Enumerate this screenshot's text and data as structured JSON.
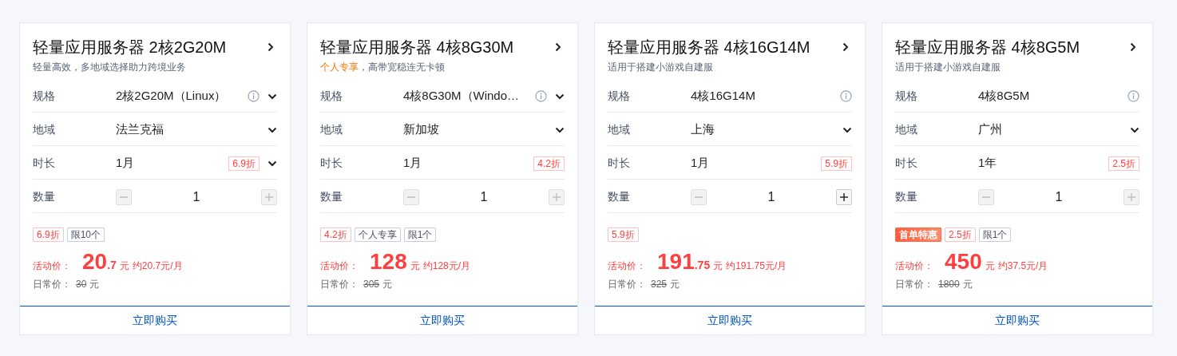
{
  "cards": [
    {
      "title": "轻量应用服务器 2核2G20M",
      "subtitle": [
        {
          "kind": "plain",
          "text": "轻量高效，多地域选择助力跨境业务"
        }
      ],
      "rows": [
        {
          "kind": "spec",
          "label": "规格",
          "value": "2核2G20M（Linux）",
          "dropdown": true
        },
        {
          "kind": "region",
          "label": "地域",
          "value": "法兰克福",
          "dropdown": true
        },
        {
          "kind": "duration",
          "label": "时长",
          "value": "1月",
          "discount": "6.9折",
          "dropdown": true
        },
        {
          "kind": "quantity",
          "label": "数量",
          "value": "1",
          "minus_disabled": true,
          "plus_disabled": true
        }
      ],
      "tags": [
        {
          "kind": "discount",
          "text": "6.9折"
        },
        {
          "kind": "plain",
          "text": "限10个"
        }
      ],
      "price": {
        "label": "活动价：",
        "integer": "20",
        "decimal": ".7",
        "unit": "元",
        "monthly": "约20.7元/月"
      },
      "regular": {
        "label": "日常价：",
        "value": "30",
        "unit": "元"
      },
      "buy": "立即购买"
    },
    {
      "title": "轻量应用服务器 4核8G30M",
      "subtitle": [
        {
          "kind": "highlight",
          "text": "个人专享"
        },
        {
          "kind": "plain",
          "text": "，高带宽稳连无卡顿"
        }
      ],
      "rows": [
        {
          "kind": "spec",
          "label": "规格",
          "value": "4核8G30M（Windo…",
          "dropdown": true
        },
        {
          "kind": "region",
          "label": "地域",
          "value": "新加坡",
          "dropdown": true
        },
        {
          "kind": "duration",
          "label": "时长",
          "value": "1月",
          "discount": "4.2折",
          "dropdown": false
        },
        {
          "kind": "quantity",
          "label": "数量",
          "value": "1",
          "minus_disabled": true,
          "plus_disabled": true
        }
      ],
      "tags": [
        {
          "kind": "discount",
          "text": "4.2折"
        },
        {
          "kind": "plain",
          "text": "个人专享"
        },
        {
          "kind": "plain",
          "text": "限1个"
        }
      ],
      "price": {
        "label": "活动价：",
        "integer": "128",
        "unit": "元",
        "monthly": "约128元/月"
      },
      "regular": {
        "label": "日常价：",
        "value": "305",
        "unit": "元"
      },
      "buy": "立即购买"
    },
    {
      "title": "轻量应用服务器 4核16G14M",
      "subtitle": [
        {
          "kind": "plain",
          "text": "适用于搭建小游戏自建服"
        }
      ],
      "rows": [
        {
          "kind": "spec",
          "label": "规格",
          "value": "4核16G14M",
          "dropdown": false
        },
        {
          "kind": "region",
          "label": "地域",
          "value": "上海",
          "dropdown": true
        },
        {
          "kind": "duration",
          "label": "时长",
          "value": "1月",
          "discount": "5.9折",
          "dropdown": false
        },
        {
          "kind": "quantity",
          "label": "数量",
          "value": "1",
          "minus_disabled": true,
          "plus_disabled": false
        }
      ],
      "tags": [
        {
          "kind": "discount",
          "text": "5.9折"
        }
      ],
      "price": {
        "label": "活动价：",
        "integer": "191",
        "decimal": ".75",
        "unit": "元",
        "monthly": "约191.75元/月"
      },
      "regular": {
        "label": "日常价：",
        "value": "325",
        "unit": "元"
      },
      "buy": "立即购买"
    },
    {
      "title": "轻量应用服务器 4核8G5M",
      "subtitle": [
        {
          "kind": "plain",
          "text": "适用于搭建小游戏自建服"
        }
      ],
      "rows": [
        {
          "kind": "spec",
          "label": "规格",
          "value": "4核8G5M",
          "dropdown": false
        },
        {
          "kind": "region",
          "label": "地域",
          "value": "广州",
          "dropdown": true
        },
        {
          "kind": "duration",
          "label": "时长",
          "value": "1年",
          "discount": "2.5折",
          "dropdown": false
        },
        {
          "kind": "quantity",
          "label": "数量",
          "value": "1",
          "minus_disabled": true,
          "plus_disabled": true
        }
      ],
      "tags": [
        {
          "kind": "promo",
          "text": "首单特惠"
        },
        {
          "kind": "discount",
          "text": "2.5折"
        },
        {
          "kind": "plain",
          "text": "限1个"
        }
      ],
      "price": {
        "label": "活动价：",
        "integer": "450",
        "unit": "元",
        "monthly": "约37.5元/月"
      },
      "regular": {
        "label": "日常价：",
        "value": "1800",
        "unit": "元"
      },
      "buy": "立即购买"
    }
  ]
}
